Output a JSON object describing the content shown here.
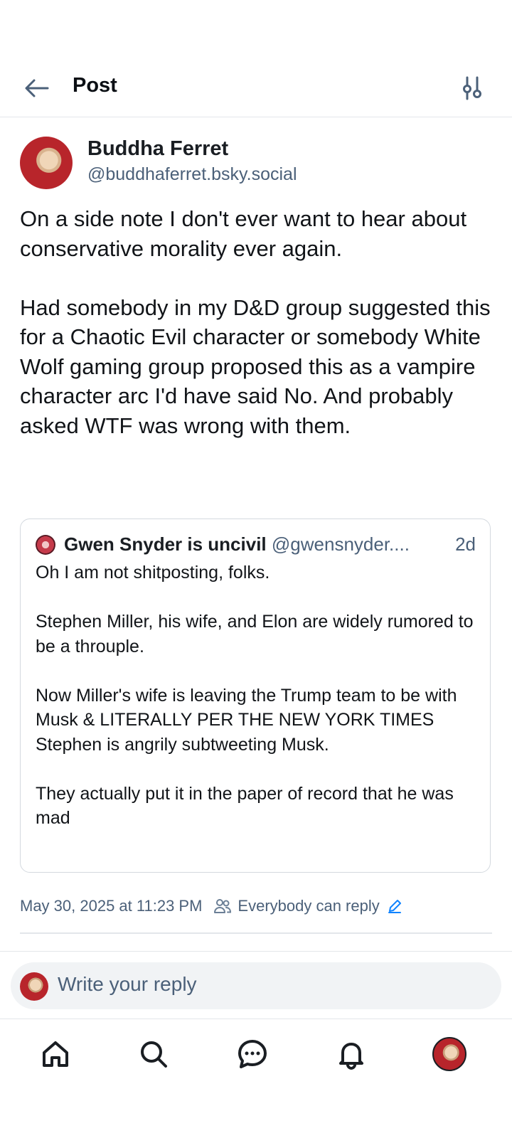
{
  "header": {
    "title": "Post",
    "back_icon": "arrow-left-icon",
    "filter_icon": "sliders-icon"
  },
  "post": {
    "author_name": "Buddha Ferret",
    "author_handle": "@buddhaferret.bsky.social",
    "text": "On a side note I don't ever want to hear about conservative morality ever again.\n\nHad somebody in my D&D group suggested this for a Chaotic Evil character or somebody White Wolf gaming group proposed this as a vampire character arc I'd have said No. And probably asked WTF was wrong with them.",
    "quote": {
      "author_name": "Gwen Snyder is uncivil",
      "author_handle": "@gwensnyder....",
      "time": "2d",
      "text": "Oh I am not shitposting, folks.\n\nStephen Miller, his wife, and Elon are widely rumored to be a throuple.\n\nNow Miller's wife is leaving the Trump team to be with Musk & LITERALLY PER THE NEW YORK TIMES Stephen is angrily subtweeting Musk.\n\nThey actually put it in the paper of record that he was mad"
    },
    "timestamp": "May 30, 2025 at 11:23 PM",
    "reply_setting": "Everybody can reply"
  },
  "reply": {
    "placeholder": "Write your reply"
  },
  "nav": [
    "home-icon",
    "search-icon",
    "chat-icon",
    "bell-icon",
    "profile-avatar"
  ],
  "colors": {
    "accent": "#1083fe",
    "muted": "#4b6079",
    "border": "#e3e6ea"
  }
}
